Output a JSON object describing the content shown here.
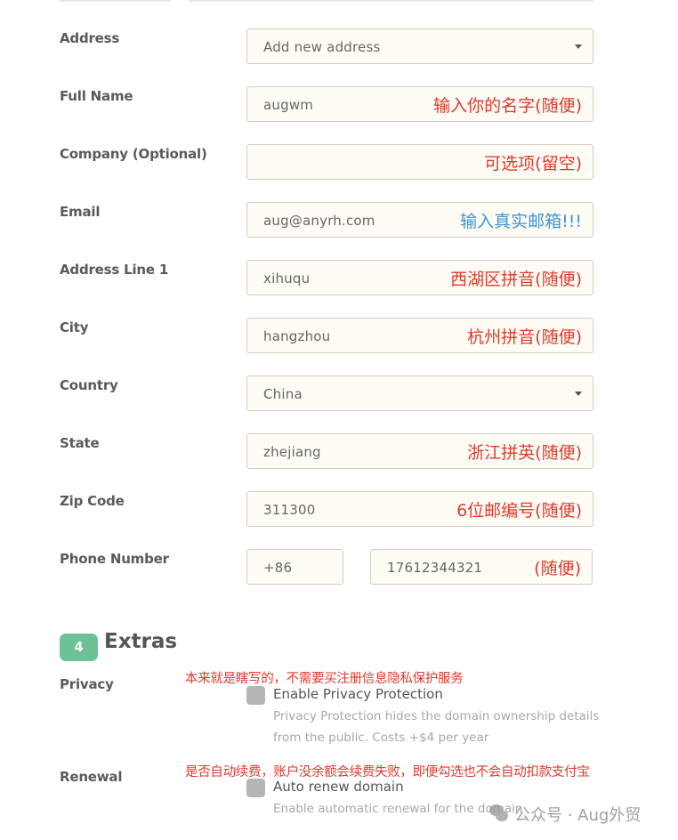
{
  "form": {
    "fields": [
      {
        "label": "Address",
        "value": "Add new address",
        "type": "select"
      },
      {
        "label": "Full Name",
        "value": "augwm",
        "annotation": "输入你的名字(随便)"
      },
      {
        "label": "Company (Optional)",
        "value": "",
        "annotation": "可选项(留空)"
      },
      {
        "label": "Email",
        "value": "aug@anyrh.com",
        "annotation": "输入真实邮箱!!!"
      },
      {
        "label": "Address Line 1",
        "value": "xihuqu",
        "annotation": "西湖区拼音(随便)"
      },
      {
        "label": "City",
        "value": "hangzhou",
        "annotation": "杭州拼音(随便)"
      },
      {
        "label": "Country",
        "value": "China",
        "type": "select"
      },
      {
        "label": "State",
        "value": "zhejiang",
        "annotation": "浙江拼英(随便)"
      },
      {
        "label": "Zip Code",
        "value": "311300",
        "annotation": "6位邮编号(随便)"
      },
      {
        "label": "Phone Number",
        "code": "+86",
        "value": "17612344321",
        "annotation": "(随便)"
      }
    ]
  },
  "extras": {
    "step": "4",
    "title": "Extras",
    "privacy": {
      "label": "Privacy",
      "annotation": "本来就是瞎写的，不需要买注册信息隐私保护服务",
      "checkbox_label": "Enable Privacy Protection",
      "checked": false,
      "help_line1": "Privacy Protection hides the domain ownership details",
      "help_line2": "from the public. Costs +$4 per year"
    },
    "renewal": {
      "label": "Renewal",
      "annotation": "是否自动续费，账户没余额会续费失败，即便勾选也不会自动扣款支付宝",
      "checkbox_label": "Auto renew domain",
      "checked": false,
      "help_line1": "Enable automatic renewal for the domain"
    }
  },
  "watermark": {
    "text": "公众号 · Aug外贸"
  },
  "colors": {
    "annotation_red": "#e03a2e",
    "annotation_blue": "#3a96d6",
    "badge_green": "#6cc296",
    "field_bg": "#fefcf4"
  }
}
